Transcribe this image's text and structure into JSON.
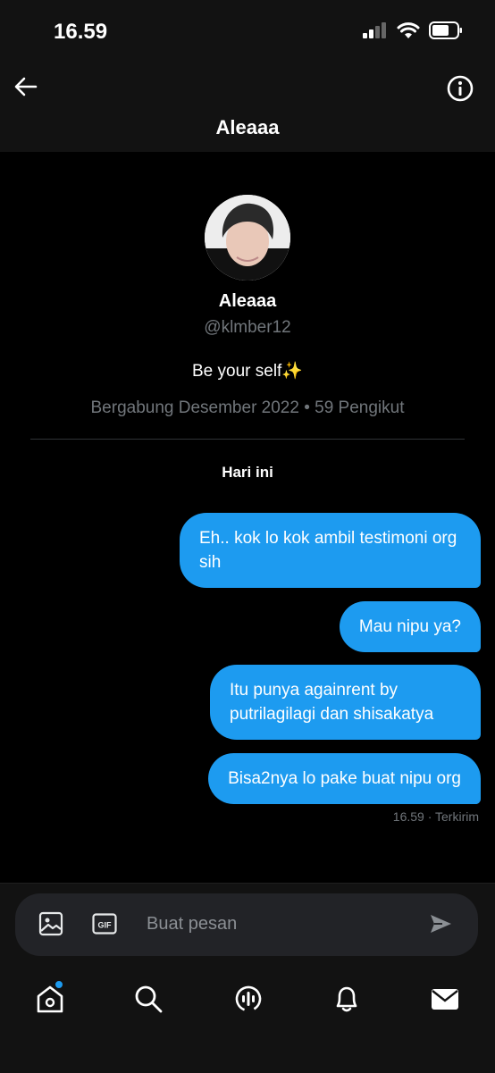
{
  "status_bar": {
    "time": "16.59"
  },
  "header": {
    "title": "Aleaaa"
  },
  "profile": {
    "name": "Aleaaa",
    "handle": "@klmber12",
    "bio": "Be your self✨",
    "meta": "Bergabung Desember 2022 • 59 Pengikut"
  },
  "conversation": {
    "day_label": "Hari ini",
    "messages": [
      {
        "text": "Eh.. kok lo kok ambil testimoni org sih"
      },
      {
        "text": "Mau nipu ya?"
      },
      {
        "text": "Itu punya againrent by putrilagilagi dan shisakatya"
      },
      {
        "text": "Bisa2nya lo pake buat nipu org"
      }
    ],
    "last_status": "16.59 · Terkirim"
  },
  "composer": {
    "placeholder": "Buat pesan",
    "gif_label": "GIF"
  },
  "nav": {
    "items": [
      {
        "icon": "home-icon"
      },
      {
        "icon": "search-icon"
      },
      {
        "icon": "spaces-icon"
      },
      {
        "icon": "bell-icon"
      },
      {
        "icon": "mail-icon"
      }
    ]
  },
  "colors": {
    "accent": "#1d9bf0",
    "background": "#000000",
    "header_bg": "#121212"
  }
}
